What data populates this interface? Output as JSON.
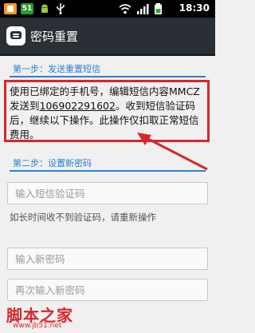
{
  "status_bar": {
    "time": "18:30",
    "badge": "51"
  },
  "header": {
    "title": "密码重置"
  },
  "step1": {
    "label": "第一步：发送重置短信",
    "instruction_pre": "使用已绑定的手机号，编辑短信内容MMCZ发送到",
    "phone": "106902291602",
    "instruction_post": "。收到短信验证码后，继续以下操作。此操作仅扣取正常短信费用。"
  },
  "step2": {
    "label": "第二步：设置新密码",
    "code_placeholder": "输入短信验证码",
    "hint": "如长时间收不到验证码，请重新操作",
    "new_password_placeholder": "输入新密码",
    "confirm_password_placeholder": "再次输入新密码"
  },
  "watermark": {
    "text": "脚本之家",
    "url": "www.jb51.net"
  },
  "colors": {
    "accent": "#2b7fd6",
    "highlight": "#d7272a",
    "titlebar": "#2a2f36"
  }
}
